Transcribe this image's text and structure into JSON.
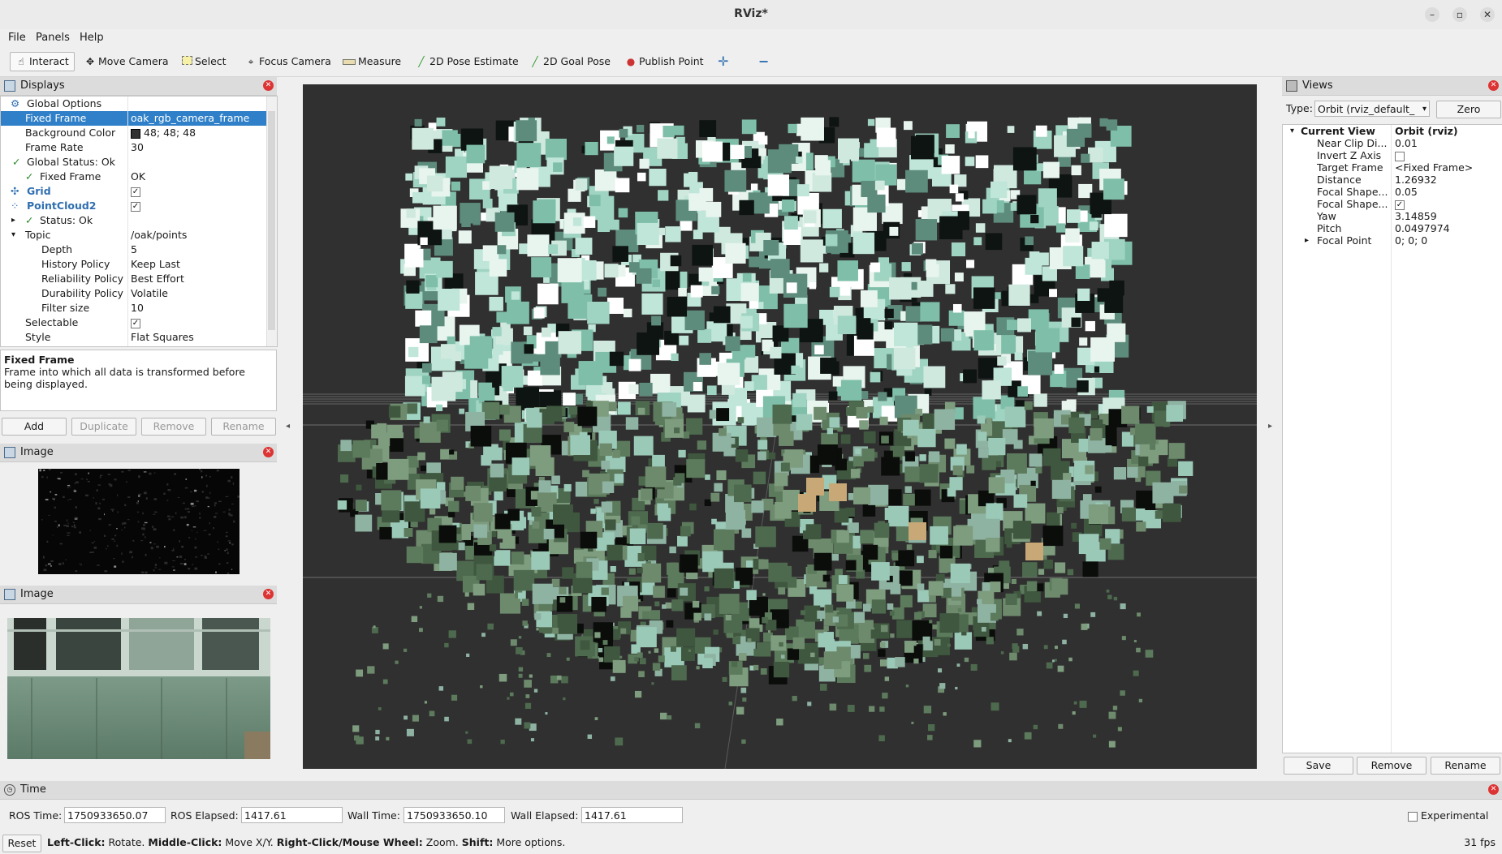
{
  "window": {
    "title": "RViz*"
  },
  "menu": [
    "File",
    "Panels",
    "Help"
  ],
  "toolbar": {
    "interact": "Interact",
    "move_camera": "Move Camera",
    "select": "Select",
    "focus_camera": "Focus Camera",
    "measure": "Measure",
    "pose_estimate": "2D Pose Estimate",
    "goal_pose": "2D Goal Pose",
    "publish_point": "Publish Point"
  },
  "displays": {
    "title": "Displays",
    "rows": [
      {
        "key": "Global Options",
        "value": ""
      },
      {
        "key": "Fixed Frame",
        "value": "oak_rgb_camera_frame"
      },
      {
        "key": "Background Color",
        "value": "48; 48; 48"
      },
      {
        "key": "Frame Rate",
        "value": "30"
      },
      {
        "key": "Global Status: Ok",
        "value": ""
      },
      {
        "key": "Fixed Frame",
        "value": "OK"
      },
      {
        "key": "Grid",
        "value": ""
      },
      {
        "key": "PointCloud2",
        "value": ""
      },
      {
        "key": "Status: Ok",
        "value": ""
      },
      {
        "key": "Topic",
        "value": "/oak/points"
      },
      {
        "key": "Depth",
        "value": "5"
      },
      {
        "key": "History Policy",
        "value": "Keep Last"
      },
      {
        "key": "Reliability Policy",
        "value": "Best Effort"
      },
      {
        "key": "Durability Policy",
        "value": "Volatile"
      },
      {
        "key": "Filter size",
        "value": "10"
      },
      {
        "key": "Selectable",
        "value": ""
      },
      {
        "key": "Style",
        "value": "Flat Squares"
      }
    ],
    "description_title": "Fixed Frame",
    "description_text": "Frame into which all data is transformed before being displayed.",
    "buttons": {
      "add": "Add",
      "duplicate": "Duplicate",
      "remove": "Remove",
      "rename": "Rename"
    }
  },
  "image_panels": [
    {
      "title": "Image"
    },
    {
      "title": "Image"
    }
  ],
  "views": {
    "title": "Views",
    "type_label": "Type:",
    "type_value": "Orbit (rviz_default_",
    "zero": "Zero",
    "rows": [
      {
        "key": "Current View",
        "value": "Orbit (rviz)"
      },
      {
        "key": "Near Clip Di...",
        "value": "0.01"
      },
      {
        "key": "Invert Z Axis",
        "value": ""
      },
      {
        "key": "Target Frame",
        "value": "<Fixed Frame>"
      },
      {
        "key": "Distance",
        "value": "1.26932"
      },
      {
        "key": "Focal Shape...",
        "value": "0.05"
      },
      {
        "key": "Focal Shape...",
        "value": ""
      },
      {
        "key": "Yaw",
        "value": "3.14859"
      },
      {
        "key": "Pitch",
        "value": "0.0497974"
      },
      {
        "key": "Focal Point",
        "value": "0; 0; 0"
      }
    ],
    "buttons": {
      "save": "Save",
      "remove": "Remove",
      "rename": "Rename"
    }
  },
  "time": {
    "title": "Time",
    "ros_time_label": "ROS Time:",
    "ros_time": "1750933650.07",
    "ros_elapsed_label": "ROS Elapsed:",
    "ros_elapsed": "1417.61",
    "wall_time_label": "Wall Time:",
    "wall_time": "1750933650.10",
    "wall_elapsed_label": "Wall Elapsed:",
    "wall_elapsed": "1417.61",
    "experimental": "Experimental"
  },
  "status": {
    "reset": "Reset",
    "b1": "Left-Click:",
    "t1": " Rotate. ",
    "b2": "Middle-Click:",
    "t2": " Move X/Y. ",
    "b3": "Right-Click/Mouse Wheel:",
    "t3": " Zoom. ",
    "b4": "Shift:",
    "t4": " More options.",
    "fps": "31 fps"
  },
  "colors": {
    "background": "#303030",
    "selection": "#2f80c8",
    "grid": "#a0a0a0"
  }
}
